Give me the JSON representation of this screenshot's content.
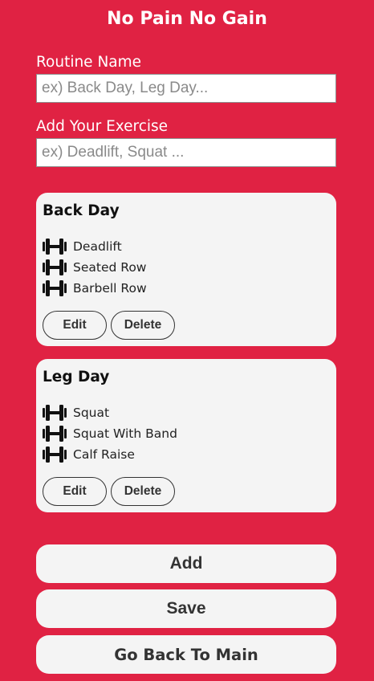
{
  "header": {
    "title": "No Pain No Gain"
  },
  "form": {
    "routine_name_label": "Routine Name",
    "routine_name_placeholder": "ex) Back Day, Leg Day...",
    "routine_name_value": "",
    "exercise_label": "Add Your Exercise",
    "exercise_placeholder": "ex) Deadlift, Squat ...",
    "exercise_value": ""
  },
  "routines": [
    {
      "title": "Back Day",
      "exercises": [
        "Deadlift",
        "Seated Row",
        "Barbell Row"
      ],
      "icon": "dumbbell-icon",
      "edit_label": "Edit",
      "delete_label": "Delete"
    },
    {
      "title": "Leg Day",
      "exercises": [
        "Squat",
        "Squat With Band",
        "Calf Raise"
      ],
      "icon": "dumbbell-icon",
      "edit_label": "Edit",
      "delete_label": "Delete"
    }
  ],
  "actions": {
    "add_label": "Add",
    "save_label": "Save",
    "back_label": "Go Back To Main"
  },
  "colors": {
    "background": "#e02243",
    "card": "#f4f4f4",
    "button_text": "#333333"
  }
}
